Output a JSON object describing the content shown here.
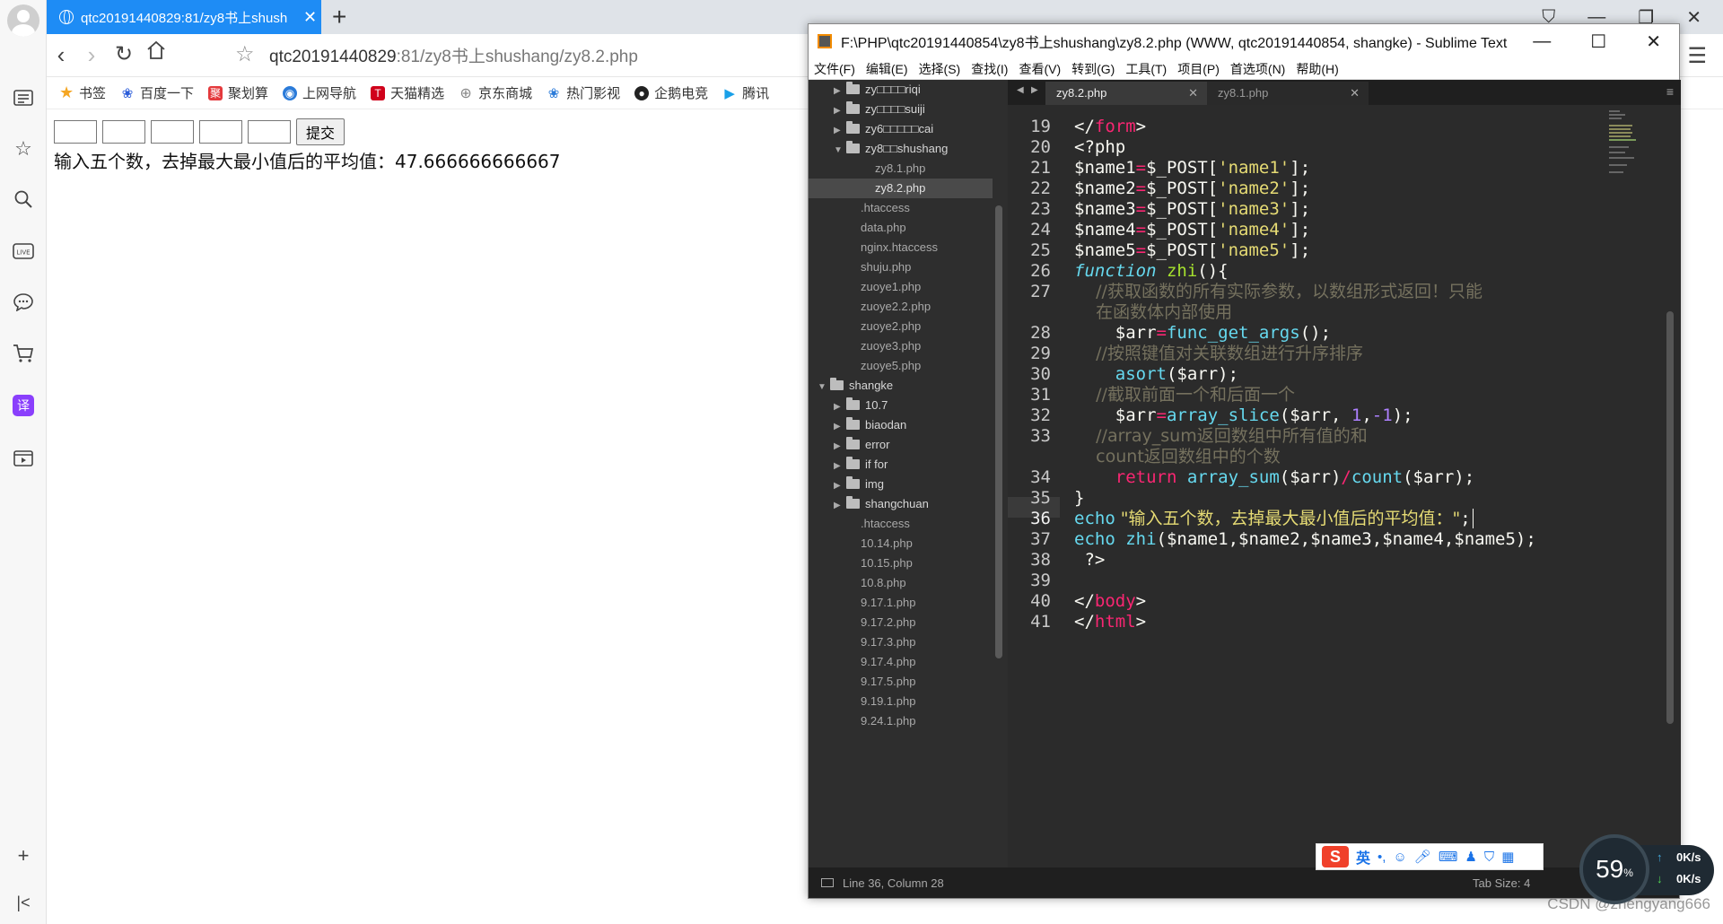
{
  "browser": {
    "tab_title": "qtc20191440829:81/zy8书上shush",
    "address": {
      "host": "qtc20191440829",
      "rest": ":81/zy8书上shushang/zy8.2.php"
    },
    "bookmarks": [
      {
        "label": "书签",
        "icon": "star-icon",
        "color": "#f5a623"
      },
      {
        "label": "百度一下",
        "icon": "baidu-paw-icon",
        "color": "#2b5cd9"
      },
      {
        "label": "聚划算",
        "icon": "juhuasuan-icon",
        "color": "#e4393c"
      },
      {
        "label": "上网导航",
        "icon": "navigation-icon",
        "color": "#2b7bd9"
      },
      {
        "label": "天猫精选",
        "icon": "tmall-icon",
        "color": "#d0021b"
      },
      {
        "label": "京东商城",
        "icon": "jd-globe-icon",
        "color": "#888888"
      },
      {
        "label": "热门影视",
        "icon": "video-paw-icon",
        "color": "#2b7bd9"
      },
      {
        "label": "企鹅电竞",
        "icon": "penguin-icon",
        "color": "#222222"
      },
      {
        "label": "腾讯",
        "icon": "tencent-video-icon",
        "color": "#19a0e8"
      }
    ]
  },
  "page": {
    "submit_label": "提交",
    "result_text": "输入五个数，去掉最大最小值后的平均值：47.666666666667"
  },
  "sublime": {
    "title": "F:\\PHP\\qtc20191440854\\zy8书上shushang\\zy8.2.php (WWW, qtc20191440854, shangke) - Sublime Text",
    "menu": [
      "文件(F)",
      "编辑(E)",
      "选择(S)",
      "查找(I)",
      "查看(V)",
      "转到(G)",
      "工具(T)",
      "项目(P)",
      "首选项(N)",
      "帮助(H)"
    ],
    "tabs": [
      {
        "label": "zy8.2.php"
      },
      {
        "label": "zy8.1.php"
      }
    ],
    "sidebar": [
      {
        "label": "zy□□□□riqi",
        "type": "folder",
        "state": "closed"
      },
      {
        "label": "zy□□□□suiji",
        "type": "folder",
        "state": "closed"
      },
      {
        "label": "zy6□□□□□cai",
        "type": "folder",
        "state": "closed"
      },
      {
        "label": "zy8□□shushang",
        "type": "folder",
        "state": "open"
      },
      {
        "label": "zy8.1.php",
        "type": "file"
      },
      {
        "label": "zy8.2.php",
        "type": "file"
      },
      {
        "label": ".htaccess",
        "type": "file"
      },
      {
        "label": "data.php",
        "type": "file"
      },
      {
        "label": "nginx.htaccess",
        "type": "file"
      },
      {
        "label": "shuju.php",
        "type": "file"
      },
      {
        "label": "zuoye1.php",
        "type": "file"
      },
      {
        "label": "zuoye2.2.php",
        "type": "file"
      },
      {
        "label": "zuoye2.php",
        "type": "file"
      },
      {
        "label": "zuoye3.php",
        "type": "file"
      },
      {
        "label": "zuoye5.php",
        "type": "file"
      },
      {
        "label": "shangke",
        "type": "folder",
        "state": "open"
      },
      {
        "label": "10.7",
        "type": "folder",
        "state": "closed"
      },
      {
        "label": "biaodan",
        "type": "folder",
        "state": "closed"
      },
      {
        "label": "error",
        "type": "folder",
        "state": "closed"
      },
      {
        "label": "if for",
        "type": "folder",
        "state": "closed"
      },
      {
        "label": "img",
        "type": "folder",
        "state": "closed"
      },
      {
        "label": "shangchuan",
        "type": "folder",
        "state": "closed"
      },
      {
        "label": ".htaccess",
        "type": "file"
      },
      {
        "label": "10.14.php",
        "type": "file"
      },
      {
        "label": "10.15.php",
        "type": "file"
      },
      {
        "label": "10.8.php",
        "type": "file"
      },
      {
        "label": "9.17.1.php",
        "type": "file"
      },
      {
        "label": "9.17.2.php",
        "type": "file"
      },
      {
        "label": "9.17.3.php",
        "type": "file"
      },
      {
        "label": "9.17.4.php",
        "type": "file"
      },
      {
        "label": "9.17.5.php",
        "type": "file"
      },
      {
        "label": "9.19.1.php",
        "type": "file"
      },
      {
        "label": "9.24.1.php",
        "type": "file"
      }
    ],
    "line_numbers": [
      "19",
      "20",
      "21",
      "22",
      "23",
      "24",
      "25",
      "26",
      "27",
      "",
      "28",
      "29",
      "30",
      "31",
      "32",
      "33",
      "",
      "34",
      "35",
      "36",
      "37",
      "38",
      "39",
      "40",
      "41"
    ],
    "code": {
      "l19a": "</",
      "l19b": "form",
      "l19c": ">",
      "l20": "<?php",
      "l21a": "$name1",
      "l21b": "=",
      "l21c": "$_POST[",
      "l21d": "'name1'",
      "l21e": "];",
      "l22a": "$name2",
      "l22b": "=",
      "l22c": "$_POST[",
      "l22d": "'name2'",
      "l22e": "];",
      "l23a": "$name3",
      "l23b": "=",
      "l23c": "$_POST[",
      "l23d": "'name3'",
      "l23e": "];",
      "l24a": "$name4",
      "l24b": "=",
      "l24c": "$_POST[",
      "l24d": "'name4'",
      "l24e": "];",
      "l25a": "$name5",
      "l25b": "=",
      "l25c": "$_POST[",
      "l25d": "'name5'",
      "l25e": "];",
      "l26a": "function",
      "l26b": " zhi",
      "l26c": "(){",
      "l27": "    //获取函数的所有实际参数，以数组形式返回！只能",
      "l27w": "    在函数体内部使用",
      "l28a": "    $arr",
      "l28b": "=",
      "l28c": "func_get_args",
      "l28d": "();",
      "l29": "    //按照键值对关联数组进行升序排序",
      "l30a": "    asort",
      "l30b": "($arr);",
      "l31": "    //截取前面一个和后面一个",
      "l32a": "    $arr",
      "l32b": "=",
      "l32c": "array_slice",
      "l32d": "($arr, ",
      "l32e": "1",
      "l32f": ",",
      "l32g": "-1",
      "l32h": ");",
      "l33": "    //array_sum返回数组中所有值的和",
      "l33w": "    count返回数组中的个数",
      "l34a": "    return",
      "l34b": " array_sum",
      "l34c": "($arr)",
      "l34d": "/",
      "l34e": "count",
      "l34f": "($arr);",
      "l35": "}",
      "l36a": "echo",
      "l36b": " \"输入五个数，去掉最大最小值后的平均值：\"",
      "l36c": ";",
      "l37a": "echo",
      "l37b": " zhi",
      "l37c": "($name1,$name2,$name3,$name4,$name5);",
      "l38": " ?>",
      "l40a": "</",
      "l40b": "body",
      "l40c": ">",
      "l41a": "</",
      "l41b": "html",
      "l41c": ">"
    },
    "status_left": "Line 36, Column 28",
    "status_right": "Tab Size: 4"
  },
  "ime": {
    "mode_label": "英"
  },
  "netmeter": {
    "percent": "59",
    "percent_sign": "%",
    "up": "0K/s",
    "down": "0K/s"
  },
  "watermark": "CSDN @zhengyang666"
}
